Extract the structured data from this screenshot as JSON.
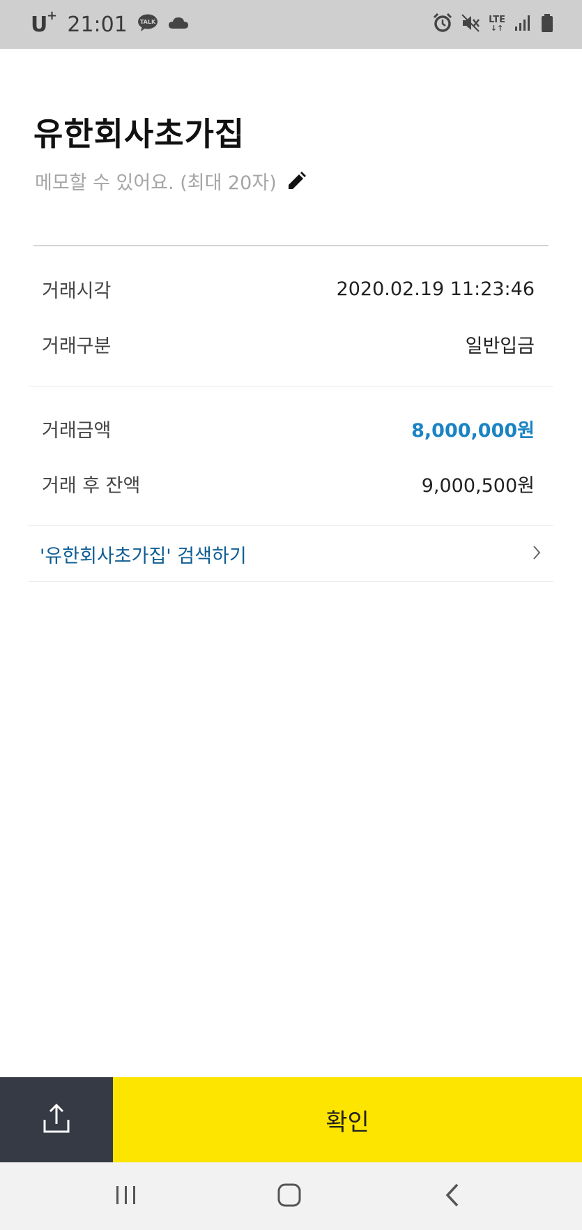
{
  "status_bar": {
    "carrier": "U",
    "carrier_sup": "+",
    "time": "21:01",
    "talk_badge": "TALK",
    "network": "LTE",
    "icons": [
      "talk-icon",
      "cloud-icon",
      "alarm-icon",
      "mute-icon",
      "lte-icon",
      "signal-icon",
      "battery-icon"
    ]
  },
  "header": {
    "title": "유한회사초가집",
    "memo_placeholder": "메모할 수 있어요. (최대 20자)"
  },
  "details": {
    "rows": [
      {
        "label": "거래시각",
        "value": "2020.02.19 11:23:46"
      },
      {
        "label": "거래구분",
        "value": "일반입금"
      },
      {
        "label": "거래금액",
        "value": "8,000,000원"
      },
      {
        "label": "거래 후 잔액",
        "value": "9,000,500원"
      }
    ]
  },
  "search": {
    "label": "'유한회사초가집' 검색하기"
  },
  "actions": {
    "confirm_label": "확인"
  },
  "colors": {
    "amount": "#1a83c3",
    "search_link": "#0d5d93",
    "confirm_bg": "#fde500",
    "share_bg": "#353a45",
    "status_bar_bg": "#cfcfcf"
  }
}
